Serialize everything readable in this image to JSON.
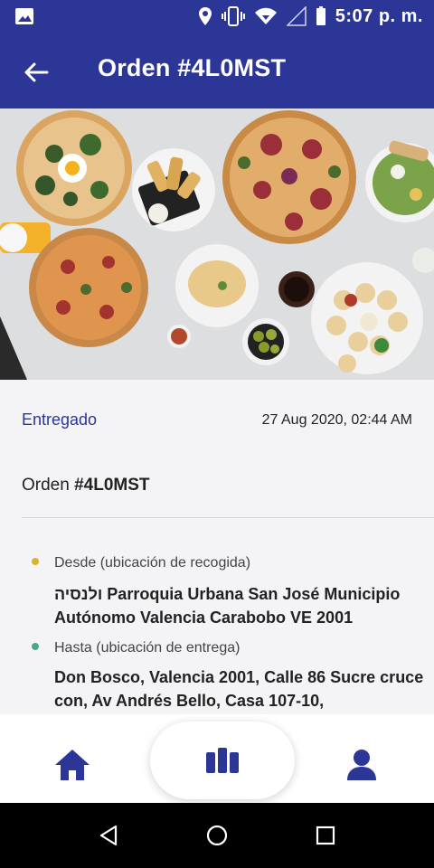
{
  "status_bar": {
    "time": "5:07 p. m.",
    "icons": [
      "image-icon",
      "location-icon",
      "vibrate-icon",
      "wifi-icon",
      "signal-icon",
      "battery-icon"
    ]
  },
  "app_bar": {
    "title": "Orden #4L0MST",
    "back_icon": "arrow-back-icon"
  },
  "hero": {
    "image": "food-spread-photo"
  },
  "order": {
    "status": "Entregado",
    "datetime": "27 Aug 2020, 02:44 AM",
    "label": "Orden ",
    "code": "#4L0MST"
  },
  "pickup": {
    "label": "Desde (ubicación de recogida)",
    "address": "ולנסיה Parroquia Urbana San José Municipio Autónomo Valencia Carabobo VE 2001"
  },
  "dropoff": {
    "label": "Hasta (ubicación de entrega)",
    "address": "Don Bosco, Valencia 2001, Calle 86 Sucre cruce con, Av Andrés Bello, Casa 107-10,"
  },
  "bottom_nav": {
    "items": [
      "home-icon",
      "orders-icon",
      "profile-icon"
    ]
  },
  "system_nav": {
    "items": [
      "back-icon",
      "home-circle-icon",
      "recents-icon"
    ]
  },
  "colors": {
    "primary": "#2b3696",
    "pickup_dot": "#d4b52a",
    "dropoff_dot": "#4aa68a"
  }
}
